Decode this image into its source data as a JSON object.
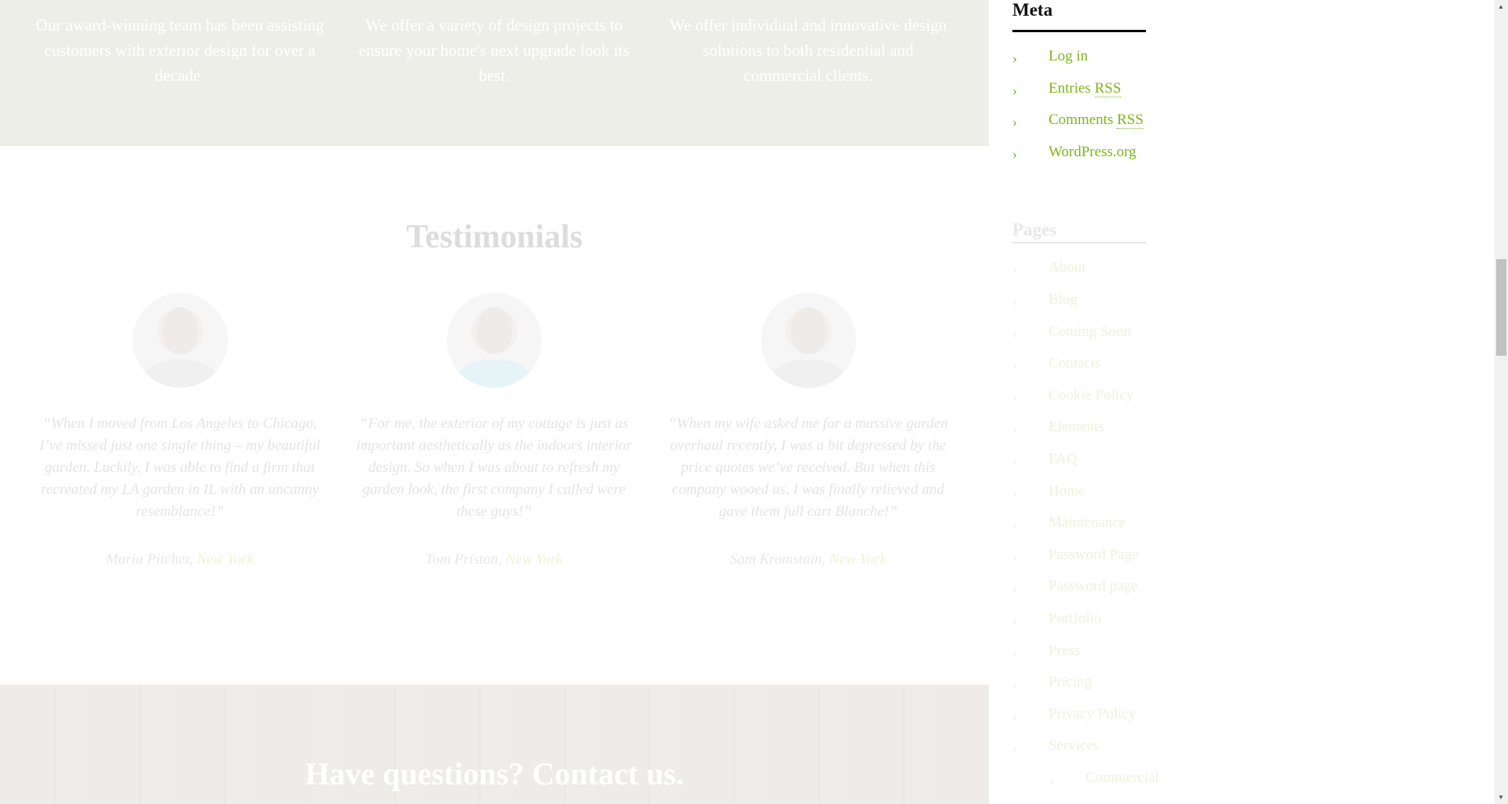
{
  "features": [
    "Our award-winning team has been assisting customers with exterior design for over a decade.",
    "We offer a variety of design projects to ensure your home's next upgrade look its best.",
    "We offer individual and innovative design solutions to both residential and commercial clients."
  ],
  "testimonials": {
    "title": "Testimonials",
    "items": [
      {
        "quote": "“When I moved from Los Angeles to Chicago, I’ve missed just one single thing – my beautiful garden. Luckily, I was able to find a firm that recreated my LA garden in IL with an uncanny resemblance!”",
        "name": "Maria Pitcher,",
        "city": "New York"
      },
      {
        "quote": "“For me, the exterior of my cottage is just as important aesthetically as the indoors interior design. So when I was about to refresh my garden look, the first company I called were these guys!”",
        "name": "Tom Priston,",
        "city": "New York"
      },
      {
        "quote": "“When my wife asked me for a massive garden overhaul recently, I was a bit depressed by the price quotes we’ve received. But when this company wooed us, I was finally relieved and gave them full cart Blanche!”",
        "name": "Sam Kromstain,",
        "city": "New York"
      }
    ]
  },
  "contact": {
    "heading": "Have questions? Contact us."
  },
  "sidebar": {
    "meta": {
      "title": "Meta",
      "items": [
        {
          "label": "Log in"
        },
        {
          "label": "Entries ",
          "abbr": "RSS"
        },
        {
          "label": "Comments ",
          "abbr": "RSS"
        },
        {
          "label": "WordPress.org"
        }
      ]
    },
    "pages": {
      "title": "Pages",
      "items": [
        "About",
        "Blog",
        "Coming Soon",
        "Contacts",
        "Cookie Policy",
        "Elements",
        "FAQ",
        "Home",
        "Maintenance",
        "Password Page",
        "Password page",
        "Portfolio",
        "Press",
        "Pricing",
        "Privacy Policy",
        "Services"
      ],
      "subitems": [
        "Commercial"
      ]
    }
  },
  "colors": {
    "accent": "#7fb51a",
    "band": "#eeeee8"
  },
  "icons": {
    "bullet": "chevron-right-icon"
  }
}
